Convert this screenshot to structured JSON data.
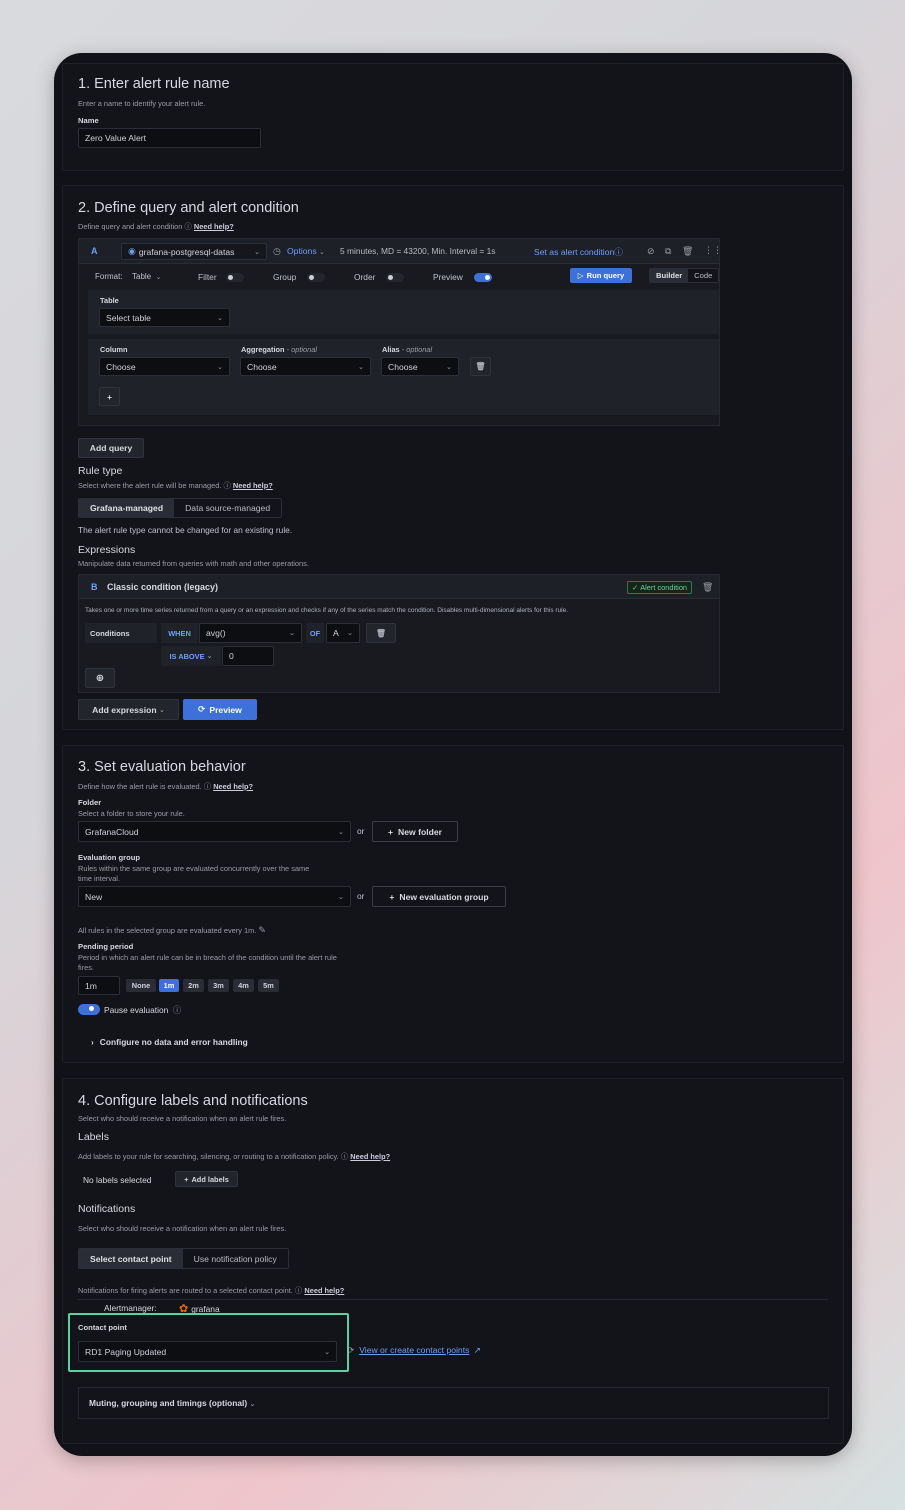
{
  "section1": {
    "title": "1. Enter alert rule name",
    "desc": "Enter a name to identify your alert rule.",
    "name_label": "Name",
    "name_value": "Zero Value Alert"
  },
  "section2": {
    "title": "2. Define query and alert condition",
    "desc": "Define query and alert condition",
    "need_help": "Need help?",
    "query": {
      "ref": "A",
      "datasource": "grafana-postgresql-datas",
      "options_label": "Options",
      "options_summary": "5 minutes, MD = 43200, Min. Interval = 1s",
      "set_alert": "Set as alert condition",
      "format_label": "Format:",
      "format_value": "Table",
      "filter_label": "Filter",
      "group_label": "Group",
      "order_label": "Order",
      "preview_label": "Preview",
      "run_query": "Run query",
      "builder": "Builder",
      "code": "Code",
      "table_label": "Table",
      "table_placeholder": "Select table",
      "column_label": "Column",
      "aggregation_label": "Aggregation",
      "alias_label": "Alias",
      "optional": "- optional",
      "choose": "Choose",
      "add_row": "+"
    },
    "add_query": "Add query",
    "rule_type": {
      "title": "Rule type",
      "desc": "Select where the alert rule will be managed.",
      "need_help": "Need help?",
      "options": [
        "Grafana-managed",
        "Data source-managed"
      ],
      "note": "The alert rule type cannot be changed for an existing rule."
    },
    "expressions": {
      "title": "Expressions",
      "desc": "Manipulate data returned from queries with math and other operations.",
      "ref": "B",
      "name": "Classic condition (legacy)",
      "badge": "Alert condition",
      "info": "Takes one or more time series returned from a query or an expression and checks if any of the series match the condition. Disables multi-dimensional alerts for this rule.",
      "conditions_label": "Conditions",
      "when": "WHEN",
      "func": "avg()",
      "of": "OF",
      "of_value": "A",
      "is_above": "IS ABOVE",
      "threshold": "0"
    },
    "add_expression": "Add expression",
    "preview": "Preview"
  },
  "section3": {
    "title": "3. Set evaluation behavior",
    "desc": "Define how the alert rule is evaluated.",
    "need_help": "Need help?",
    "folder_label": "Folder",
    "folder_desc": "Select a folder to store your rule.",
    "folder_value": "GrafanaCloud",
    "or": "or",
    "new_folder": "New folder",
    "group_label": "Evaluation group",
    "group_desc1": "Rules within the same group are evaluated concurrently over the same",
    "group_desc2": "time interval.",
    "group_value": "New",
    "new_group": "New evaluation group",
    "interval_note": "All rules in the selected group are evaluated every 1m.",
    "pending_label": "Pending period",
    "pending_desc1": "Period in which an alert rule can be in breach of the condition until the alert rule",
    "pending_desc2": "fires.",
    "pending_value": "1m",
    "pending_options": [
      "None",
      "1m",
      "2m",
      "3m",
      "4m",
      "5m"
    ],
    "pause": "Pause evaluation",
    "configure": "Configure no data and error handling"
  },
  "section4": {
    "title": "4. Configure labels and notifications",
    "desc": "Select who should receive a notification when an alert rule fires.",
    "labels_title": "Labels",
    "labels_desc": "Add labels to your rule for searching, silencing, or routing to a notification policy.",
    "need_help": "Need help?",
    "no_labels": "No labels selected",
    "add_labels": "Add labels",
    "notif_title": "Notifications",
    "notif_desc": "Select who should receive a notification when an alert rule fires.",
    "notif_options": [
      "Select contact point",
      "Use notification policy"
    ],
    "routed_note": "Notifications for firing alerts are routed to a selected contact point.",
    "alertmanager_label": "Alertmanager:",
    "alertmanager_value": "grafana",
    "contact_label": "Contact point",
    "contact_value": "RD1 Paging Updated",
    "view_link": "View or create contact points",
    "muting": "Muting, grouping and timings (optional)"
  },
  "colors": {
    "accent": "#3d71d9",
    "highlight": "#5ed0a0",
    "grafana_logo": "#f46800"
  },
  "icons": [
    "help-icon",
    "postgres-icon",
    "clock-icon",
    "copy-icon",
    "delete-icon",
    "drag-icon",
    "play-icon",
    "refresh-icon",
    "plus-icon",
    "edit-icon",
    "chevron-right-icon",
    "external-link-icon",
    "grafana-logo-icon",
    "check-icon"
  ]
}
